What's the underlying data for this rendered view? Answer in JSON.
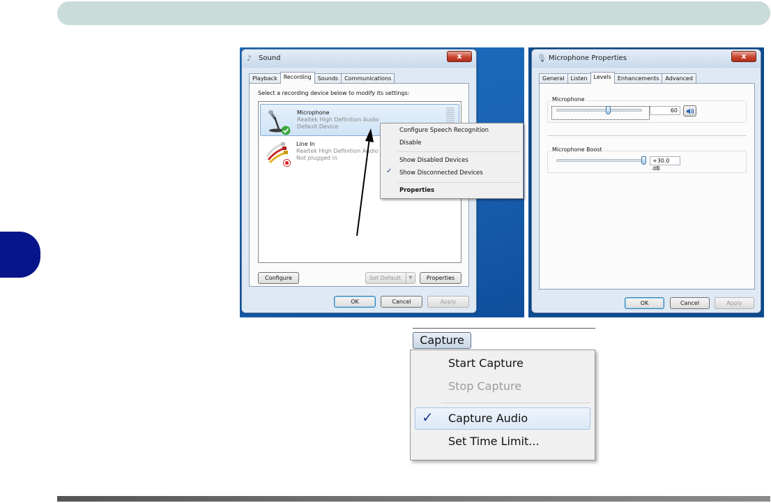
{
  "colors": {
    "header": "#c9dcd9",
    "side_tab": "#07158a",
    "desktop": "#1a64b4",
    "accent": "#1e3f8f"
  },
  "sound_dialog": {
    "title": "Sound",
    "close_label": "x",
    "tabs": [
      {
        "label": "Playback",
        "active": false
      },
      {
        "label": "Recording",
        "active": true
      },
      {
        "label": "Sounds",
        "active": false
      },
      {
        "label": "Communications",
        "active": false
      }
    ],
    "instruction": "Select a recording device below to modify its settings:",
    "devices": [
      {
        "name": "Microphone",
        "driver": "Realtek High Definition Audio",
        "status": "Default Device",
        "icon": "microphone-icon",
        "status_icon": "green-check-icon",
        "selected": true
      },
      {
        "name": "Line In",
        "driver": "Realtek High Definition Audio",
        "status": "Not plugged in",
        "icon": "line-in-cable-icon",
        "status_icon": "red-unplugged-icon",
        "selected": false
      }
    ],
    "buttons": {
      "configure": "Configure",
      "set_default": "Set Default",
      "properties": "Properties",
      "ok": "OK",
      "cancel": "Cancel",
      "apply": "Apply"
    }
  },
  "context_menu": {
    "items": [
      {
        "label": "Configure Speech Recognition",
        "checked": false,
        "bold": false
      },
      {
        "label": "Disable",
        "checked": false,
        "bold": false
      },
      {
        "label": "Show Disabled Devices",
        "checked": false,
        "bold": false
      },
      {
        "label": "Show Disconnected Devices",
        "checked": true,
        "bold": false
      },
      {
        "label": "Properties",
        "checked": false,
        "bold": true
      }
    ]
  },
  "mic_properties": {
    "title": "Microphone Properties",
    "close_label": "x",
    "tabs": [
      {
        "label": "General",
        "active": false
      },
      {
        "label": "Listen",
        "active": false
      },
      {
        "label": "Levels",
        "active": true
      },
      {
        "label": "Enhancements",
        "active": false
      },
      {
        "label": "Advanced",
        "active": false
      }
    ],
    "microphone": {
      "label": "Microphone",
      "value": 60,
      "value_text": "60",
      "speaker_icon": "speaker-icon"
    },
    "boost": {
      "label": "Microphone Boost",
      "value_text": "+30.0 dB",
      "fraction": 1.0
    },
    "buttons": {
      "ok": "OK",
      "cancel": "Cancel",
      "apply": "Apply"
    }
  },
  "capture_menu": {
    "title": "Capture",
    "items": [
      {
        "label": "Start Capture",
        "disabled": false,
        "checked": false
      },
      {
        "label": "Stop Capture",
        "disabled": true,
        "checked": false
      },
      {
        "label": "Capture Audio",
        "disabled": false,
        "checked": true
      },
      {
        "label": "Set Time Limit...",
        "disabled": false,
        "checked": false
      }
    ]
  }
}
